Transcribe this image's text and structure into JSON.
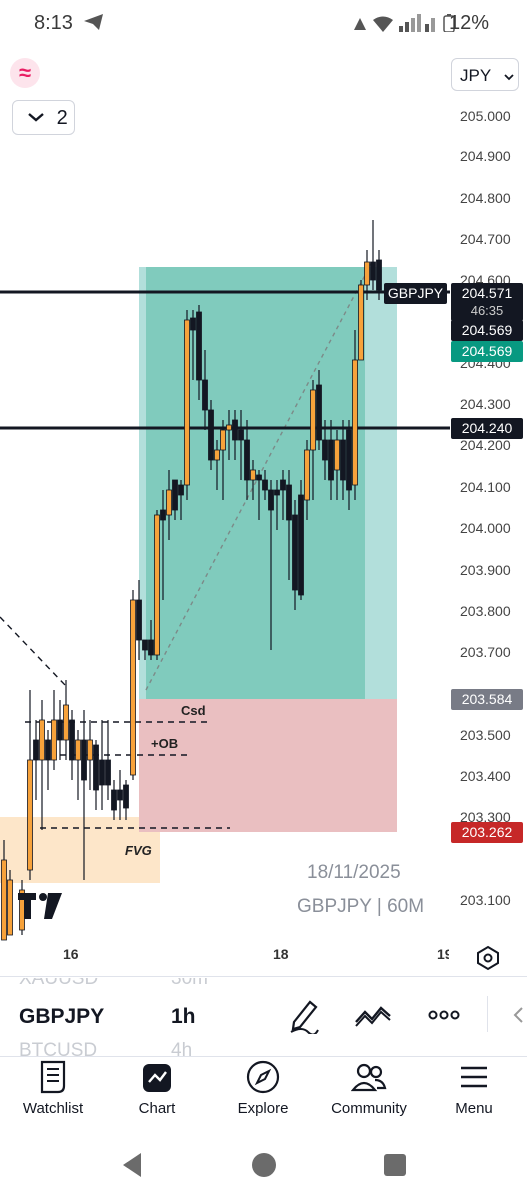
{
  "status_bar": {
    "time": "8:13",
    "battery": "12%"
  },
  "toolbar": {
    "currency_button": "JPY",
    "layers_count": "2"
  },
  "price_axis": {
    "labels": [
      "205.000",
      "204.900",
      "204.800",
      "204.700",
      "204.600",
      "204.400",
      "204.300",
      "204.200",
      "204.100",
      "204.000",
      "203.900",
      "203.800",
      "203.700",
      "203.500",
      "203.400",
      "203.300",
      "203.100"
    ],
    "badges": {
      "symbol": "GBPJPY",
      "last_price": "204.571",
      "countdown": "46:35",
      "bid": "204.569",
      "ask": "204.569",
      "hline": "204.240",
      "stop_top": "203.584",
      "stop_bottom": "203.262"
    },
    "colors": {
      "dark": "#131722",
      "green": "#089981",
      "gray": "#787b86",
      "red": "#c62828"
    }
  },
  "time_axis": {
    "labels": [
      "16",
      "18",
      "19"
    ]
  },
  "annotations": {
    "csd": "Csd",
    "ob": "+OB",
    "fvg": "FVG"
  },
  "watermark": {
    "date": "18/11/2025",
    "symbol_tf": "GBPJPY | 60M"
  },
  "symbol_list": {
    "prev_symbol": "XAUUSD",
    "prev_tf": "30m",
    "current_symbol": "GBPJPY",
    "current_tf": "1h",
    "next_symbol": "BTCUSD",
    "next_tf": "4h"
  },
  "nav": {
    "watchlist": "Watchlist",
    "chart": "Chart",
    "explore": "Explore",
    "community": "Community",
    "menu": "Menu"
  }
}
